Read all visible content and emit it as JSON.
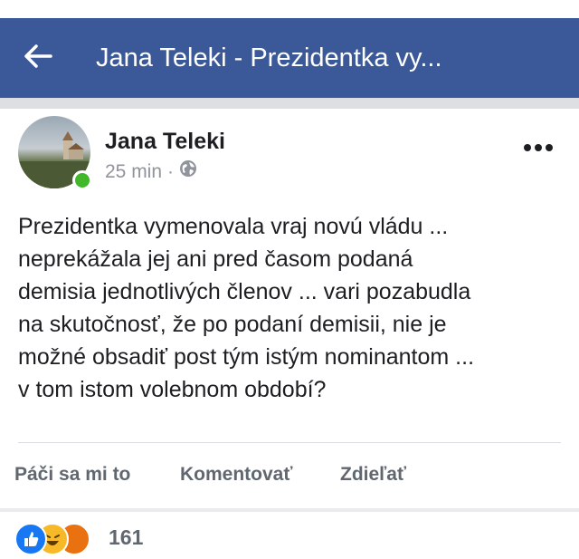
{
  "navbar": {
    "title": "Jana Teleki - Prezidentka vy...",
    "back_icon": "arrow-left-icon",
    "background": "#3b5998"
  },
  "post": {
    "author": "Jana Teleki",
    "time": "25 min",
    "meta_separator": "·",
    "privacy_icon": "globe-icon",
    "more_icon": "more-horizontal-icon",
    "online_color": "#42b72a",
    "text_lines": [
      "Prezidentka vymenovala vraj novú vládu ...",
      "neprekážala jej ani pred časom podaná",
      "demisia jednotlivých členov ... vari pozabudla",
      "na skutočnosť, že po podaní demisii, nie je",
      "možné obsadiť post tým istým nominantom ...",
      "v tom istom volebnom období?"
    ]
  },
  "actions": {
    "like": "Páči sa mi to",
    "comment": "Komentovať",
    "share": "Zdieľať"
  },
  "reactions": {
    "icons": [
      "like-reaction-icon",
      "haha-reaction-icon",
      "angry-reaction-icon"
    ],
    "count": "161"
  }
}
